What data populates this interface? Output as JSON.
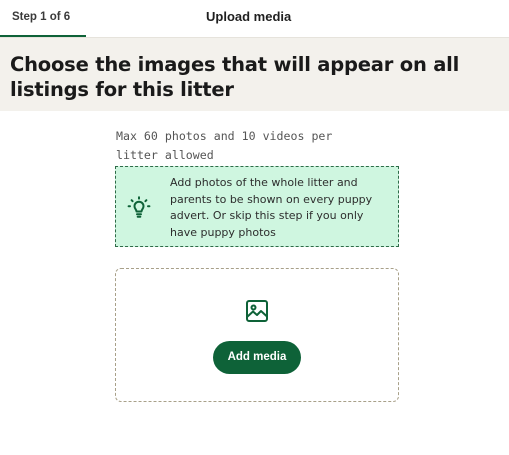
{
  "header": {
    "step_label": "Step 1 of 6",
    "title": "Upload media"
  },
  "hero": {
    "title": "Choose the images that will appear on all listings for this litter"
  },
  "main": {
    "limit_text": "Max 60 photos and 10 videos per litter allowed",
    "tip": {
      "icon": "lightbulb-icon",
      "text": "Add photos of the whole litter and parents to be shown on every puppy advert. Or skip this step if you only have puppy photos"
    },
    "upload": {
      "icon": "image-icon",
      "button_label": "Add media"
    }
  },
  "colors": {
    "brand_green": "#0e6238",
    "tip_background": "#cff6e0",
    "hero_background": "#f3f1ec"
  }
}
